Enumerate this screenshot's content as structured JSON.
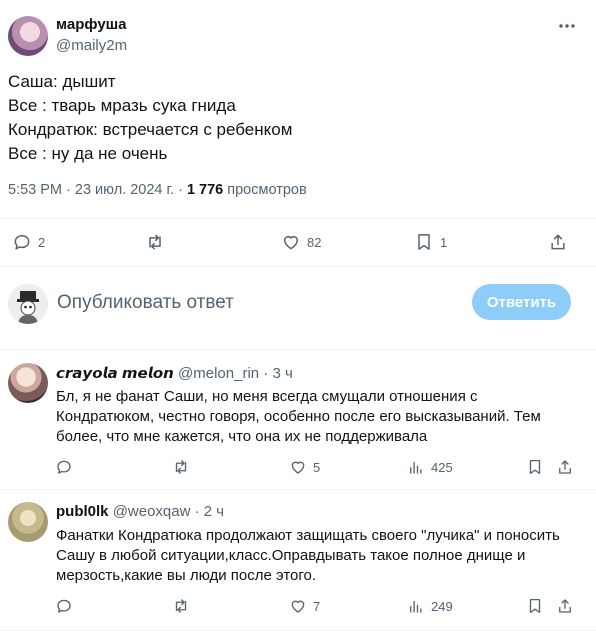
{
  "main_tweet": {
    "author_name": "марфуша",
    "author_handle": "@maily2m",
    "lines": [
      "Саша: дышит",
      "Все : тварь мразь сука гнида",
      "Кондратюк: встречается с ребенком",
      "Все : ну да не очень"
    ],
    "time": "5:53 PM · 23 июл. 2024 г. · ",
    "views_count": "1 776",
    "views_label": " просмотров",
    "actions": {
      "replies": "2",
      "retweets": "",
      "likes": "82",
      "bookmarks": "1"
    }
  },
  "composer": {
    "placeholder": "Опубликовать ответ",
    "button_label": "Ответить"
  },
  "replies": [
    {
      "name": "𝙘𝙧𝙖𝙮𝙤𝙡𝙖 𝙢𝙚𝙡𝙤𝙣",
      "handle": "@melon_rin · 3 ч",
      "text": "Бл, я не фанат Саши, но меня всегда смущали отношения с Кондратюком, честно говоря, особенно после его высказываний. Тем более, что мне кажется, что она их не поддерживала",
      "likes": "5",
      "views": "425"
    },
    {
      "name": "publ0lk",
      "handle": "@weoxqaw · 2 ч",
      "text": "Фанатки Кондратюка продолжают защищать своего \"лучика\" и поносить Сашу в любой ситуации,класс.Оправдывать такое полное днище и мерзость,какие вы люди после этого.",
      "likes": "7",
      "views": "249"
    }
  ],
  "icons": [
    "more-icon",
    "reply-icon",
    "retweet-icon",
    "like-icon",
    "bookmark-icon",
    "share-icon",
    "views-icon"
  ],
  "colors": {
    "accent": "#1d9bf0",
    "button_disabled": "#8ecdf8",
    "muted": "#536471",
    "text": "#0f1419"
  }
}
